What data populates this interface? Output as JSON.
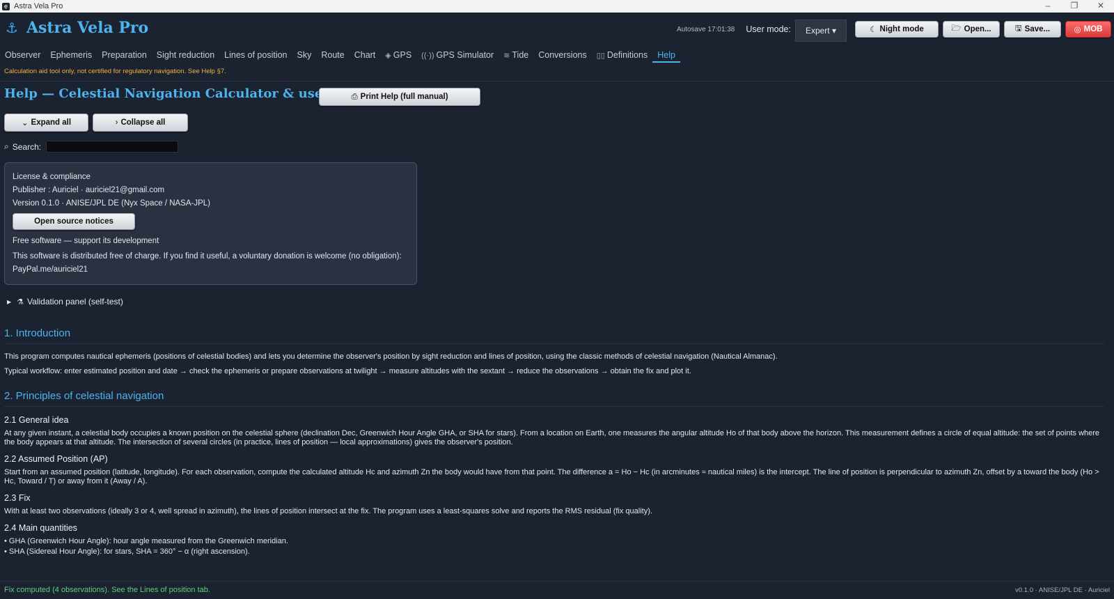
{
  "window": {
    "title": "Astra Vela Pro",
    "icon": "e",
    "controls": [
      "–",
      "❐",
      "✕"
    ]
  },
  "header": {
    "app_name": "Astra Vela Pro",
    "autosave": "Autosave 17:01:38",
    "user_mode_label": "User mode:",
    "user_mode_value": "Expert ▾",
    "buttons": {
      "night": "Night mode",
      "open": "Open...",
      "save": "Save...",
      "mob": "MOB"
    }
  },
  "nav": {
    "tabs": [
      {
        "label": "Observer",
        "icon": ""
      },
      {
        "label": "Ephemeris",
        "icon": ""
      },
      {
        "label": "Preparation",
        "icon": ""
      },
      {
        "label": "Sight reduction",
        "icon": ""
      },
      {
        "label": "Lines of position",
        "icon": ""
      },
      {
        "label": "Sky",
        "icon": ""
      },
      {
        "label": "Route",
        "icon": ""
      },
      {
        "label": "Chart",
        "icon": ""
      },
      {
        "label": "GPS",
        "icon": "◈"
      },
      {
        "label": "GPS Simulator",
        "icon": "((·))"
      },
      {
        "label": "Tide",
        "icon": "≋"
      },
      {
        "label": "Conversions",
        "icon": ""
      },
      {
        "label": "Definitions",
        "icon": "▯▯"
      },
      {
        "label": "Help",
        "icon": ""
      }
    ],
    "active": "Help"
  },
  "warning": "Calculation aid tool only, not certified for regulatory navigation. See Help §7.",
  "help": {
    "title": "Help — Celestial Navigation Calculator & user guide",
    "print_button": "Print Help (full manual)",
    "expand_all": "Expand all",
    "collapse_all": "Collapse all",
    "search_label": "Search:",
    "search_value": ""
  },
  "license": {
    "title": "License & compliance",
    "publisher": "Publisher : Auriciel · auriciel21@gmail.com",
    "version": "Version 0.1.0 · ANISE/JPL DE (Nyx Space / NASA-JPL)",
    "open_source_button": "Open source notices",
    "free_title": "Free software — support its development",
    "donation_text": "This software is distributed free of charge. If you find it useful, a voluntary donation is welcome (no obligation):",
    "paypal": "PayPal.me/auriciel21"
  },
  "validation": {
    "label": "Validation panel (self-test)"
  },
  "sections": {
    "intro_title": "1. Introduction",
    "intro_p1": "This program computes nautical ephemeris (positions of celestial bodies) and lets you determine the observer's position by sight reduction and lines of position, using the classic methods of celestial navigation (Nautical Almanac).",
    "intro_p2": "Typical workflow: enter estimated position and date → check the ephemeris or prepare observations at twilight → measure altitudes with the sextant → reduce the observations → obtain the fix and plot it.",
    "principles_title": "2. Principles of celestial navigation",
    "s21_title": "2.1 General idea",
    "s21_text": "At any given instant, a celestial body occupies a known position on the celestial sphere (declination Dec, Greenwich Hour Angle GHA, or SHA for stars). From a location on Earth, one measures the angular altitude Ho of that body above the horizon. This measurement defines a circle of equal altitude: the set of points where the body appears at that altitude. The intersection of several circles (in practice, lines of position — local approximations) gives the observer's position.",
    "s22_title": "2.2 Assumed Position (AP)",
    "s22_text": "Start from an assumed position (latitude, longitude). For each observation, compute the calculated altitude Hc and azimuth Zn the body would have from that point. The difference a = Ho − Hc (in arcminutes ≈ nautical miles) is the intercept. The line of position is perpendicular to azimuth Zn, offset by a toward the body (Ho > Hc, Toward / T) or away from it (Away / A).",
    "s23_title": "2.3 Fix",
    "s23_text": "With at least two observations (ideally 3 or 4, well spread in azimuth), the lines of position intersect at the fix. The program uses a least-squares solve and reports the RMS residual (fix quality).",
    "s24_title": "2.4 Main quantities",
    "s24_item1": "• GHA (Greenwich Hour Angle): hour angle measured from the Greenwich meridian.",
    "s24_item2": "• SHA (Sidereal Hour Angle): for stars, SHA = 360° − α (right ascension)."
  },
  "status": {
    "left": "Fix computed (4 observations). See the Lines of position tab.",
    "right": "v0.1.0 · ANISE/JPL DE · Auriciel"
  },
  "colors": {
    "accent": "#4db4ee",
    "warning": "#f0b240",
    "status_ok": "#5fcf80",
    "mob": "#d93b3b"
  },
  "icons": [
    "anchor-icon",
    "moon-icon",
    "folder-icon",
    "save-icon",
    "target-icon",
    "printer-icon",
    "chevron-down-icon",
    "chevron-right-icon",
    "search-icon",
    "flask-icon"
  ]
}
